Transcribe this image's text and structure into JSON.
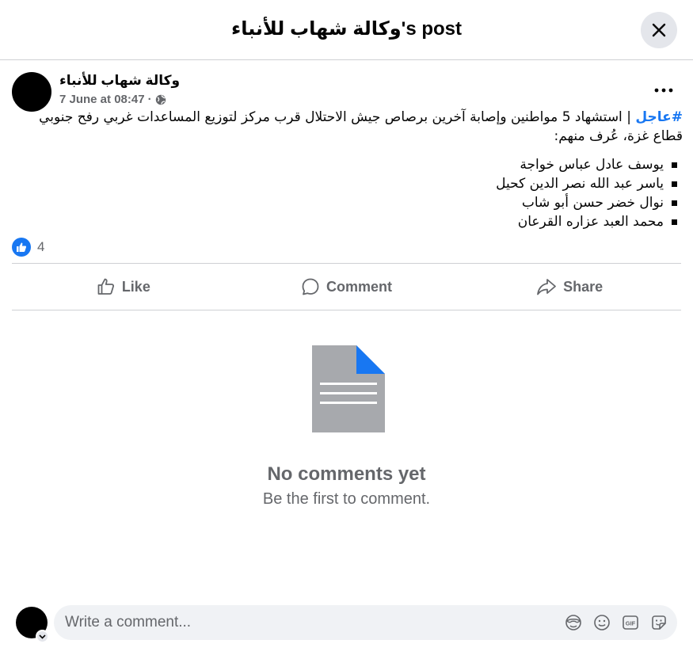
{
  "header": {
    "title": "وكالة شهاب للأنباء's post"
  },
  "post": {
    "author": "وكالة شهاب للأنباء",
    "timestamp": "7 June at 08:47",
    "separator": "·",
    "hashtag": "#عاجل",
    "body": " | استشهاد 5 مواطنين وإصابة آخرين برصاص جيش الاحتلال قرب مركز لتوزيع المساعدات غربي رفح جنوبي قطاع غزة، عُرف منهم:",
    "names": [
      "يوسف عادل عباس خواجة",
      "ياسر عبد الله نصر الدين كحيل",
      "نوال خضر حسن أبو شاب",
      "محمد العبد عزاره القرعان"
    ],
    "reaction_count": "4"
  },
  "actions": {
    "like": "Like",
    "comment": "Comment",
    "share": "Share"
  },
  "empty_state": {
    "title": "No comments yet",
    "subtitle": "Be the first to comment."
  },
  "composer": {
    "placeholder": "Write a comment..."
  },
  "colors": {
    "accent": "#1877f2",
    "secondary_text": "#65676b",
    "divider": "#ced0d4",
    "input_bg": "#f0f2f5"
  }
}
